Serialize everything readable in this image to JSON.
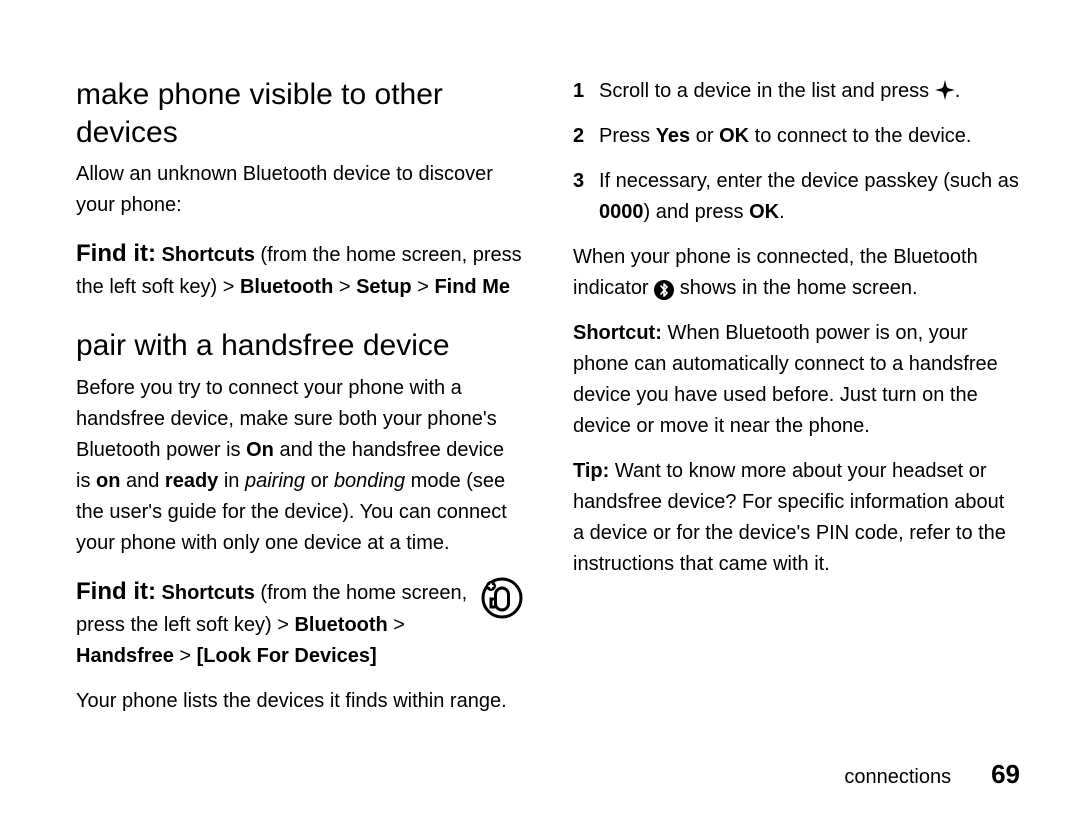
{
  "left": {
    "h1": "make phone visible to other devices",
    "p1": "Allow an unknown Bluetooth device to discover your phone:",
    "find1_lead": "Find it:",
    "find1_a": " Shortcuts",
    "find1_b": " (from the home screen, press the left soft key) > ",
    "find1_c": "Bluetooth",
    "find1_d": " > ",
    "find1_e": "Setup",
    "find1_f": " > ",
    "find1_g": "Find Me",
    "h2": "pair with a handsfree device",
    "p2a": "Before you try to connect your phone with a handsfree device, make sure both your phone's Bluetooth power is ",
    "p2b_on1": "On",
    "p2c": " and the handsfree device is ",
    "p2d_on2": "on",
    "p2e": " and ",
    "p2f_ready": "ready",
    "p2g": " in ",
    "p2h_pairing": "pairing",
    "p2i": " or ",
    "p2j_bonding": "bonding",
    "p2k": " mode (see the user's guide for the device). You can connect your phone with only one device at a time.",
    "find2_lead": "Find it:",
    "find2_a": " Shortcuts",
    "find2_b": " (from the home screen, press the left soft key) > ",
    "find2_c": "Bluetooth",
    "find2_d": " > ",
    "find2_e": "Handsfree",
    "find2_f": " > ",
    "find2_g": "[Look For Devices]",
    "p3": "Your phone lists the devices it finds within range."
  },
  "right": {
    "li1a": "Scroll to a device in the list and press ",
    "li1b": ".",
    "li2a": "Press ",
    "li2b": "Yes",
    "li2c": " or ",
    "li2d": "OK",
    "li2e": " to connect to the device.",
    "li3a": "If necessary, enter the device passkey (such as ",
    "li3b": "0000",
    "li3c": ") and press ",
    "li3d": "OK",
    "li3e": ".",
    "p1a": "When your phone is connected, the Bluetooth indicator ",
    "p1b": " shows in the home screen.",
    "p2a": "Shortcut:",
    "p2b": " When Bluetooth power is on, your phone can automatically connect to a handsfree device you have used before. Just turn on the device or move it near the phone.",
    "p3a": "Tip:",
    "p3b": " Want to know more about your headset or handsfree device? For specific information about a device or for the device's PIN code, refer to the instructions that came with it."
  },
  "nums": {
    "n1": "1",
    "n2": "2",
    "n3": "3"
  },
  "footer": {
    "section": "connections",
    "page": "69"
  },
  "icons": {
    "bt_glyph": "B"
  }
}
